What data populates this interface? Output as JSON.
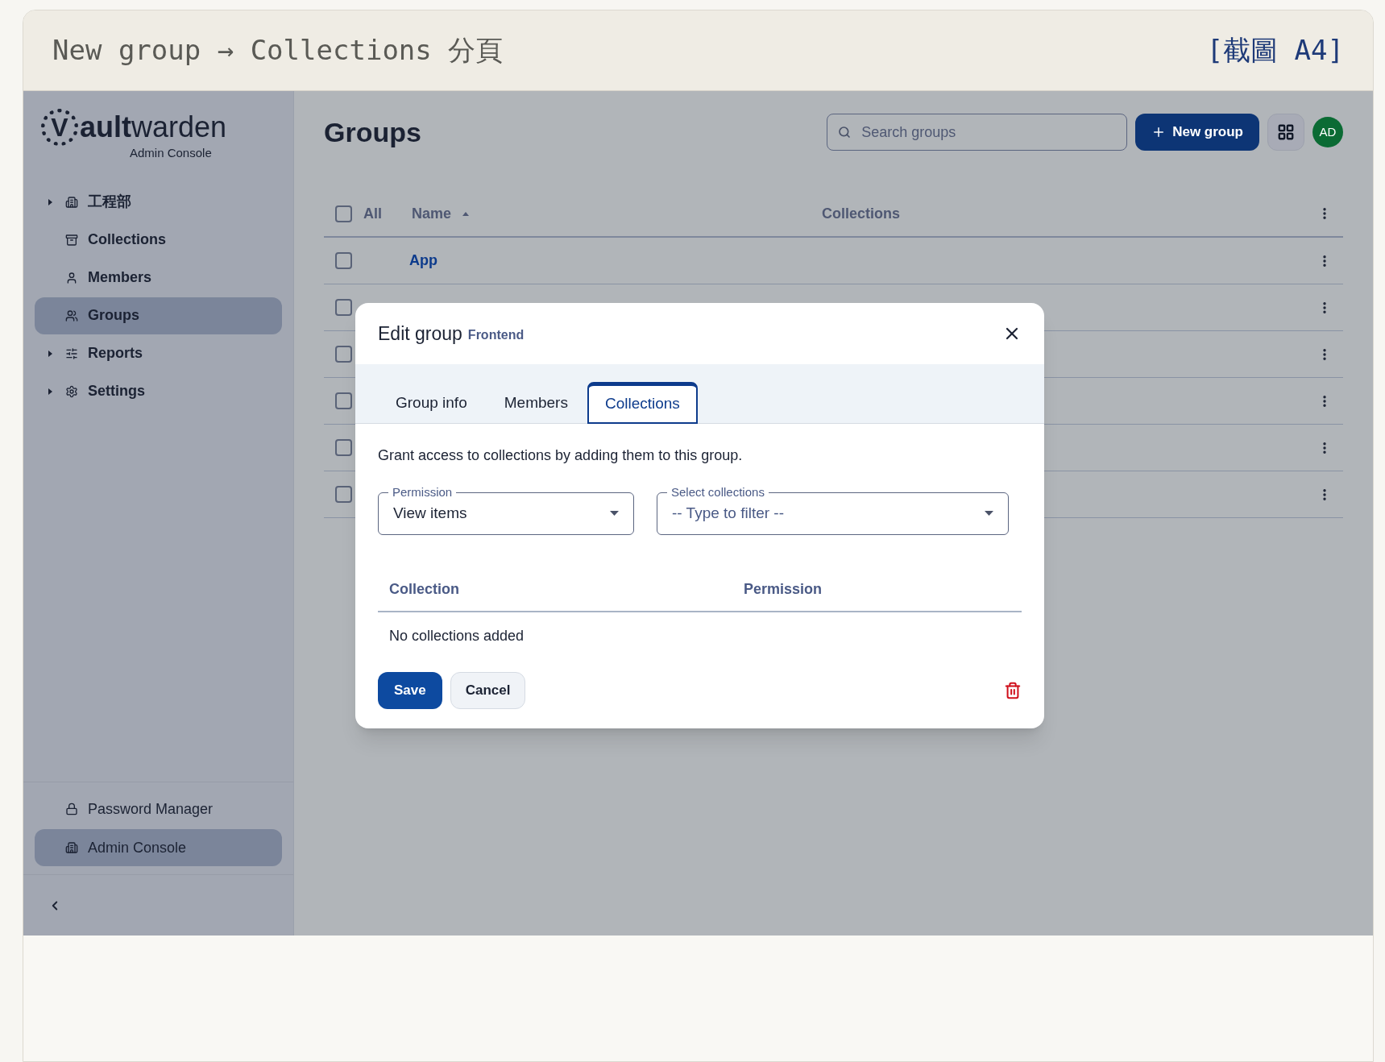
{
  "caption": {
    "title": "New group → Collections 分頁",
    "tag": "[截圖 A4]"
  },
  "sidebar": {
    "logo": {
      "letter": "V",
      "bold": "ault",
      "light": "warden",
      "subtitle": "Admin Console"
    },
    "items": [
      {
        "label": "工程部",
        "kind": "folder",
        "expanded": false,
        "selected": false
      },
      {
        "label": "Collections",
        "kind": "link",
        "selected": false
      },
      {
        "label": "Members",
        "kind": "link",
        "selected": false
      },
      {
        "label": "Groups",
        "kind": "link",
        "selected": true
      },
      {
        "label": "Reports",
        "kind": "folder",
        "expanded": false,
        "selected": false
      },
      {
        "label": "Settings",
        "kind": "folder",
        "expanded": false,
        "selected": false
      }
    ],
    "footer_items": [
      {
        "label": "Password Manager",
        "selected": false
      },
      {
        "label": "Admin Console",
        "selected": true
      }
    ]
  },
  "topbar": {
    "title": "Groups",
    "search": {
      "placeholder": "Search groups"
    },
    "new_button": "New group",
    "avatar": "AD"
  },
  "table": {
    "select_all": {
      "label": "All",
      "checked": false
    },
    "columns": [
      "Name",
      "Collections"
    ],
    "rows": [
      {
        "name": "App",
        "checked": false
      },
      {
        "checked": false
      },
      {
        "checked": false
      },
      {
        "checked": false
      },
      {
        "checked": false
      },
      {
        "checked": false
      }
    ]
  },
  "dialog": {
    "title": "Edit group",
    "subtitle": "Frontend",
    "tabs": [
      {
        "label": "Group info",
        "selected": false
      },
      {
        "label": "Members",
        "selected": false
      },
      {
        "label": "Collections",
        "selected": true
      }
    ],
    "description": "Grant access to collections by adding them to this group.",
    "permission": {
      "label": "Permission",
      "value": "View items"
    },
    "collections_select": {
      "label": "Select collections",
      "placeholder": "-- Type to filter --"
    },
    "columns": [
      "Collection",
      "Permission"
    ],
    "empty": "No collections added",
    "buttons": [
      "Save",
      "Cancel"
    ]
  }
}
